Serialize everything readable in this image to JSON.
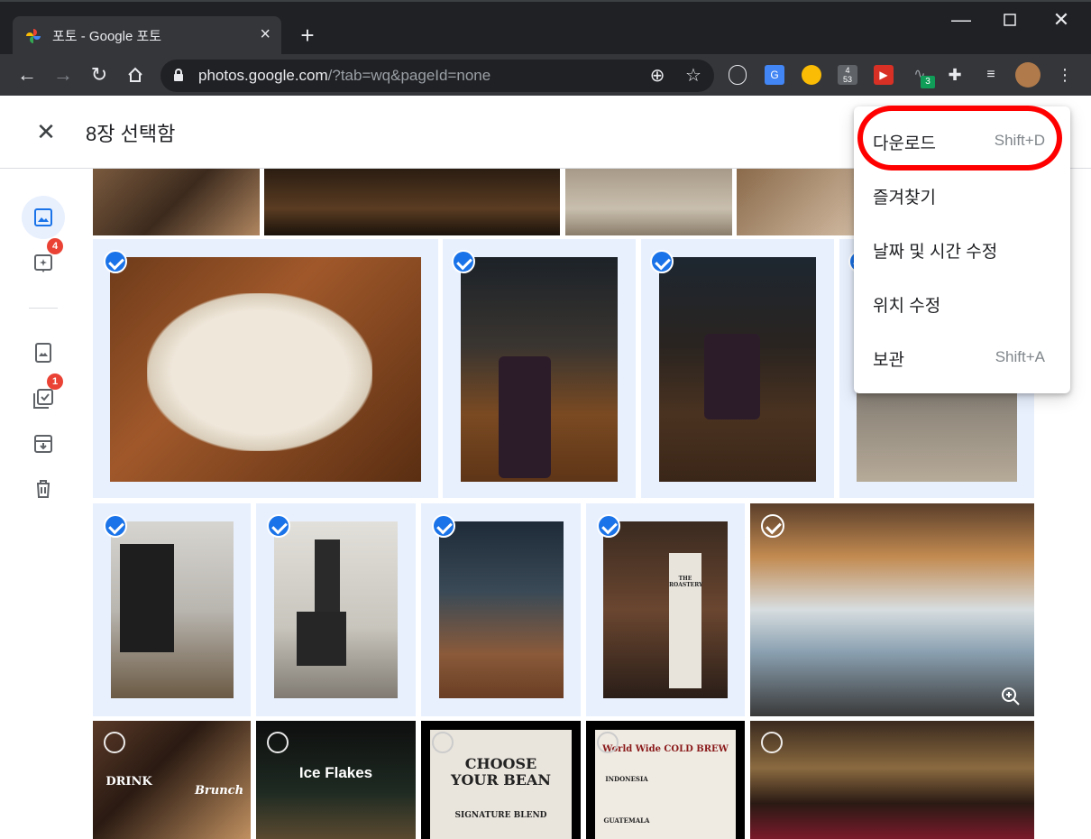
{
  "browser": {
    "tab_title": "포토 - Google 포토",
    "tab_close": "×",
    "new_tab": "+",
    "url_host": "photos.google.com",
    "url_path": "/?tab=wq&pageId=none",
    "ext_badge_53": "4\n53",
    "ext_count": "3"
  },
  "appbar": {
    "close_icon": "✕",
    "selection_count": "8장 선택함"
  },
  "rail": {
    "assistant_badge": "4",
    "sharing_badge": "1"
  },
  "menu": {
    "items": [
      {
        "label": "다운로드",
        "shortcut": "Shift+D"
      },
      {
        "label": "즐겨찾기",
        "shortcut": ""
      },
      {
        "label": "날짜 및 시간 수정",
        "shortcut": ""
      },
      {
        "label": "위치 수정",
        "shortcut": ""
      },
      {
        "label": "보관",
        "shortcut": "Shift+A"
      }
    ]
  },
  "photo_text": {
    "choose": "CHOOSE",
    "your_bean": "YOUR BEAN",
    "signature": "SIGNATURE BLEND",
    "cold_brew": "World Wide COLD BREW",
    "ice_flakes": "Ice Flakes",
    "drink": "DRINK",
    "brunch": "Brunch",
    "roastery": "THE ROASTERY",
    "indonesia": "INDONESIA",
    "guatemala": "GUATEMALA"
  },
  "colors": {
    "chrome_bg": "#202124",
    "selected_bg": "#e8f0fe",
    "check_blue": "#1a73e8",
    "badge_red": "#ea4335",
    "annotation_red": "#ff0000"
  }
}
